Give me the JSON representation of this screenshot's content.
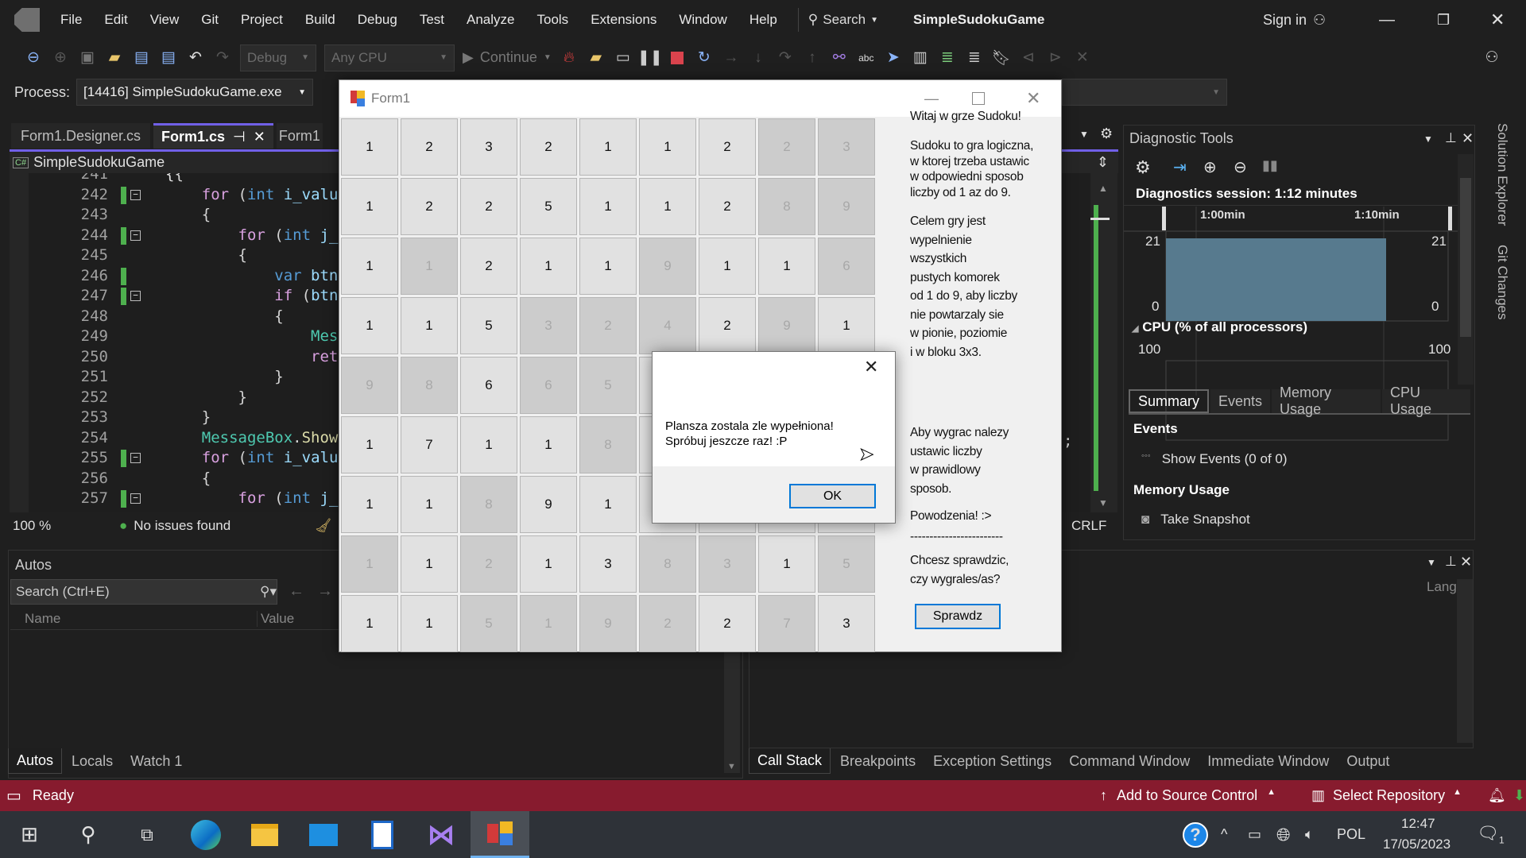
{
  "menu": {
    "items": [
      "File",
      "Edit",
      "View",
      "Git",
      "Project",
      "Build",
      "Debug",
      "Test",
      "Analyze",
      "Tools",
      "Extensions",
      "Window",
      "Help"
    ],
    "search": "Search",
    "solution_title": "SimpleSudokuGame",
    "sign_in": "Sign in"
  },
  "toolbar": {
    "config": "Debug",
    "platform": "Any CPU",
    "continue": "Continue"
  },
  "process": {
    "label": "Process:",
    "value": "[14416] SimpleSudokuGame.exe"
  },
  "doc_tabs": [
    "Form1.Designer.cs",
    "Form1.cs",
    "Form1"
  ],
  "nav": {
    "project": "SimpleSudokuGame",
    "lang_badge": "C#"
  },
  "code": {
    "first_line": 241,
    "lines": [
      {
        "n": "241",
        "s": "{",
        "t": [
          [
            "{",
            "p"
          ]
        ]
      },
      {
        "n": "242",
        "s": "    ",
        "t": [
          [
            "for",
            "k"
          ],
          [
            " (",
            "p"
          ],
          [
            "int",
            "b"
          ],
          [
            " i_valu",
            "i"
          ]
        ],
        "chg": 1,
        "fold": 1
      },
      {
        "n": "243",
        "s": "    ",
        "t": [
          [
            "{",
            "p"
          ]
        ]
      },
      {
        "n": "244",
        "s": "        ",
        "t": [
          [
            "for",
            "k"
          ],
          [
            " (",
            "p"
          ],
          [
            "int",
            "b"
          ],
          [
            " j_",
            "i"
          ]
        ],
        "chg": 1,
        "fold": 1
      },
      {
        "n": "245",
        "s": "        ",
        "t": [
          [
            "{",
            "p"
          ]
        ]
      },
      {
        "n": "246",
        "s": "            ",
        "t": [
          [
            "var",
            "b"
          ],
          [
            " btn",
            "i"
          ]
        ],
        "chg": 1
      },
      {
        "n": "247",
        "s": "            ",
        "t": [
          [
            "if",
            "k"
          ],
          [
            " (",
            "p"
          ],
          [
            "btn",
            "i"
          ]
        ],
        "chg": 1,
        "fold": 1
      },
      {
        "n": "248",
        "s": "            ",
        "t": [
          [
            "{",
            "p"
          ]
        ]
      },
      {
        "n": "249",
        "s": "                ",
        "t": [
          [
            "Mes",
            "c"
          ]
        ]
      },
      {
        "n": "250",
        "s": "                ",
        "t": [
          [
            "ret",
            "k"
          ]
        ]
      },
      {
        "n": "251",
        "s": "            ",
        "t": [
          [
            "}",
            "p"
          ]
        ]
      },
      {
        "n": "252",
        "s": "        ",
        "t": [
          [
            "}",
            "p"
          ]
        ]
      },
      {
        "n": "253",
        "s": "    ",
        "t": [
          [
            "}",
            "p"
          ]
        ]
      },
      {
        "n": "254",
        "s": "    ",
        "t": [
          [
            "MessageBox",
            "c"
          ],
          [
            ".",
            "p"
          ],
          [
            "Show",
            "m"
          ]
        ]
      },
      {
        "n": "255",
        "s": "    ",
        "t": [
          [
            "for",
            "k"
          ],
          [
            " (",
            "p"
          ],
          [
            "int",
            "b"
          ],
          [
            " i_valu",
            "i"
          ]
        ],
        "chg": 1,
        "fold": 1
      },
      {
        "n": "256",
        "s": "    ",
        "t": [
          [
            "{",
            "p"
          ]
        ]
      },
      {
        "n": "257",
        "s": "        ",
        "t": [
          [
            "for",
            "k"
          ],
          [
            " (",
            "p"
          ],
          [
            "int",
            "b"
          ],
          [
            " j_",
            "i"
          ]
        ],
        "chg": 1,
        "fold": 1
      }
    ],
    "trailing_semicolon": ";"
  },
  "token_colors": {
    "k": "#d8a0df",
    "b": "#569cd6",
    "i": "#9cdcfe",
    "p": "#d4d4d4",
    "c": "#4ec9b0",
    "m": "#dcdcaa"
  },
  "editor_status": {
    "zoom": "100 %",
    "issues": "No issues found",
    "eol": "CRLF"
  },
  "autos": {
    "title": "Autos",
    "search_placeholder": "Search (Ctrl+E)",
    "columns": [
      "Name",
      "Value"
    ],
    "tabs": [
      "Autos",
      "Locals",
      "Watch 1"
    ]
  },
  "callstack": {
    "column": "Lang",
    "tabs": [
      "Call Stack",
      "Breakpoints",
      "Exception Settings",
      "Command Window",
      "Immediate Window",
      "Output"
    ]
  },
  "diagnostics": {
    "title": "Diagnostic Tools",
    "session": "Diagnostics session: 1:12 minutes",
    "timeline": [
      "1:00min",
      "1:10min"
    ],
    "memory_max": "21",
    "memory_min": "0",
    "cpu_title": "CPU (% of all processors)",
    "cpu_max": "100",
    "tabs": [
      "Summary",
      "Events",
      "Memory Usage",
      "CPU Usage"
    ],
    "events_heading": "Events",
    "show_events": "Show Events (0 of 0)",
    "memory_heading": "Memory Usage",
    "take_snapshot": "Take Snapshot",
    "graph_color": "#577a8e"
  },
  "side_tabs": [
    "Solution Explorer",
    "Git Changes"
  ],
  "statusbar": {
    "ready": "Ready",
    "add_source": "Add to Source Control",
    "select_repo": "Select Repository",
    "color": "#871b2e"
  },
  "taskbar": {
    "lang": "POL",
    "time": "12:47",
    "date": "17/05/2023",
    "notifications": "1"
  },
  "form": {
    "title": "Form1",
    "grid": [
      [
        [
          1,
          0
        ],
        [
          2,
          0
        ],
        [
          3,
          0
        ],
        [
          2,
          0
        ],
        [
          1,
          0
        ],
        [
          1,
          0
        ],
        [
          2,
          0
        ],
        [
          2,
          1
        ],
        [
          3,
          1
        ]
      ],
      [
        [
          1,
          0
        ],
        [
          2,
          0
        ],
        [
          2,
          0
        ],
        [
          5,
          0
        ],
        [
          1,
          0
        ],
        [
          1,
          0
        ],
        [
          2,
          0
        ],
        [
          8,
          1
        ],
        [
          9,
          1
        ]
      ],
      [
        [
          1,
          0
        ],
        [
          1,
          1
        ],
        [
          2,
          0
        ],
        [
          1,
          0
        ],
        [
          1,
          0
        ],
        [
          9,
          1
        ],
        [
          1,
          0
        ],
        [
          1,
          0
        ],
        [
          6,
          1
        ]
      ],
      [
        [
          1,
          0
        ],
        [
          1,
          0
        ],
        [
          5,
          0
        ],
        [
          3,
          1
        ],
        [
          2,
          1
        ],
        [
          4,
          1
        ],
        [
          2,
          0
        ],
        [
          9,
          1
        ],
        [
          1,
          0
        ]
      ],
      [
        [
          9,
          1
        ],
        [
          8,
          1
        ],
        [
          6,
          0
        ],
        [
          6,
          1
        ],
        [
          5,
          1
        ],
        null,
        null,
        null,
        null
      ],
      [
        [
          1,
          0
        ],
        [
          7,
          0
        ],
        [
          1,
          0
        ],
        [
          1,
          0
        ],
        [
          8,
          1
        ],
        null,
        null,
        null,
        null
      ],
      [
        [
          1,
          0
        ],
        [
          1,
          0
        ],
        [
          8,
          1
        ],
        [
          9,
          0
        ],
        [
          1,
          0
        ],
        null,
        null,
        null,
        null
      ],
      [
        [
          1,
          1
        ],
        [
          1,
          0
        ],
        [
          2,
          1
        ],
        [
          1,
          0
        ],
        [
          3,
          0
        ],
        [
          8,
          1
        ],
        [
          3,
          1
        ],
        [
          1,
          0
        ],
        [
          5,
          1
        ]
      ],
      [
        [
          1,
          0
        ],
        [
          1,
          0
        ],
        [
          5,
          1
        ],
        [
          1,
          1
        ],
        [
          9,
          1
        ],
        [
          2,
          1
        ],
        [
          2,
          0
        ],
        [
          7,
          1
        ],
        [
          3,
          0
        ]
      ]
    ],
    "info": {
      "welcome": "Witaj w grze Sudoku!",
      "p1": [
        "Sudoku to gra logiczna,",
        "w ktorej trzeba ustawic",
        "w odpowiedni sposob",
        "liczby od 1 az do 9."
      ],
      "p2": [
        "Celem gry jest",
        "wypelnienie",
        "wszystkich",
        "pustych komorek",
        "od 1 do 9, aby liczby",
        "nie powtarzaly sie",
        "w pionie, poziomie",
        "i w bloku 3x3."
      ],
      "p3": [
        "Aby wygrac nalezy",
        "ustawic liczby",
        "w prawidlowy",
        "sposob."
      ],
      "luck": "Powodzenia! :>",
      "separator": "------------------------",
      "ask": [
        "Chcesz sprawdzic,",
        "czy wygrales/as?"
      ],
      "check_button": "Sprawdz"
    }
  },
  "dialog": {
    "message": [
      "Plansza zostala zle wypełniona!",
      "Spróbuj jeszcze raz! :P"
    ],
    "ok": "OK"
  }
}
